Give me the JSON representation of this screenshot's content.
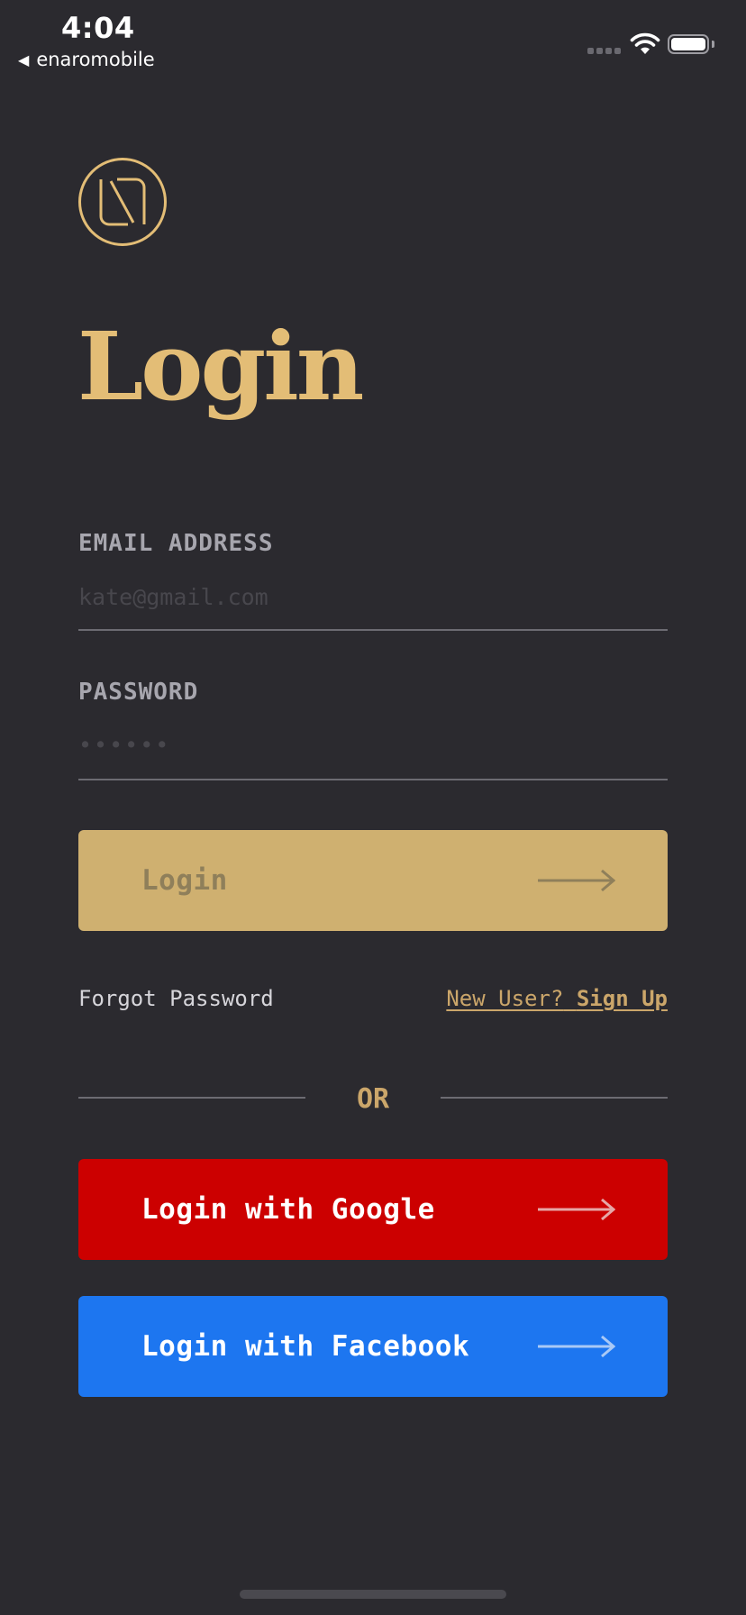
{
  "status_bar": {
    "time": "4:04",
    "back_app": "enaromobile",
    "icons": [
      "signal-icon",
      "wifi-icon",
      "battery-icon"
    ],
    "battery_level": 1.0
  },
  "header": {
    "logo_icon": "n-monogram-logo",
    "title": "Login"
  },
  "form": {
    "email": {
      "label": "EMAIL ADDRESS",
      "placeholder": "kate@gmail.com",
      "value": ""
    },
    "password": {
      "label": "PASSWORD",
      "placeholder": "••••••",
      "value": ""
    },
    "login_button": {
      "label": "Login",
      "icon": "arrow-right-icon"
    }
  },
  "links": {
    "forgot_password": "Forgot Password",
    "new_user_prefix": "New User?",
    "sign_up": "Sign Up"
  },
  "divider": {
    "text": "OR"
  },
  "social": {
    "google_label": "Login with Google",
    "facebook_label": "Login with Facebook",
    "icon": "arrow-right-icon"
  },
  "colors": {
    "background": "#2b2a2f",
    "accent_gold": "#e3bd76",
    "login_button": "#cfb070",
    "google_red": "#cc0000",
    "facebook_blue": "#1d76f0"
  }
}
